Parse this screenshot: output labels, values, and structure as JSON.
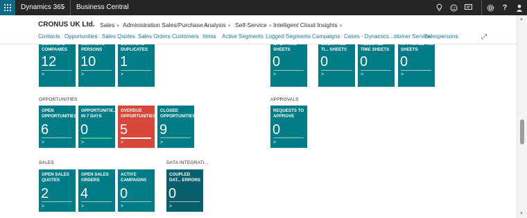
{
  "topbar": {
    "brand": "Dynamics 365",
    "product": "Business Central",
    "icons": [
      "waffle-icon",
      "chevron-down-icon",
      "lightbulb-icon",
      "smiley-icon",
      "chat-icon",
      "gear-icon",
      "help-icon",
      "user-icon"
    ]
  },
  "nav": {
    "company": "CRONUS UK Ltd.",
    "menus": [
      "Sales",
      "Administration Sales/Purchase",
      "Analysis",
      "Self-Service",
      "Intelligent Cloud Insights"
    ],
    "links": [
      "Contacts",
      "Opportunities",
      "Sales Quotes",
      "Sales Orders",
      "Customers",
      "Items",
      "Active Segments",
      "Logged Segments",
      "Campaigns",
      "Cases - Dynamics...stomer Service",
      "Salespersons"
    ],
    "expand_icon": "expand-icon"
  },
  "sections": {
    "opportunities": "OPPORTUNITIES",
    "approvals": "APPROVALS",
    "sales": "SALES",
    "data_integration": "DATA INTEGRATI..."
  },
  "tiles": {
    "contacts_companies": {
      "label": "CONTACTS - COMPANIES",
      "value": "12"
    },
    "contacts_persons": {
      "label": "CONTACTS - PERSONS",
      "value": "10"
    },
    "contacts_duplicates": {
      "label": "CONTACTS - DUPLICATES",
      "value": "1"
    },
    "open_time_sheets": {
      "label": "OPEN TIME SHEETS",
      "value": "0"
    },
    "submitted_time_sheets": {
      "label": "SUBMITTED TI... SHEETS",
      "value": "0"
    },
    "rejected_time_sheets": {
      "label": "REJECTED TIME SHEETS",
      "value": "0"
    },
    "approved_time_sheets": {
      "label": "APPROVED TI... SHEETS",
      "value": "0"
    },
    "open_opportunities": {
      "label": "OPEN OPPORTUNITIES",
      "value": "6"
    },
    "opportunities_7_days": {
      "label": "OPPORTUNITIE... IN 7 DAYS",
      "value": "0"
    },
    "overdue_opportunities": {
      "label": "OVERDUE OPPORTUNITIES",
      "value": "5"
    },
    "closed_opportunities": {
      "label": "CLOSED OPPORTUNITIES",
      "value": "9"
    },
    "requests_to_approve": {
      "label": "REQUESTS TO APPROVE",
      "value": "0"
    },
    "open_sales_quotes": {
      "label": "OPEN SALES QUOTES",
      "value": "2"
    },
    "open_sales_orders": {
      "label": "OPEN SALES ORDERS",
      "value": "4"
    },
    "active_campaigns": {
      "label": "ACTIVE CAMPAIGNS",
      "value": "0"
    },
    "coupled_data_errors": {
      "label": "COUPLED DAT... ERRORS",
      "value": "0"
    }
  },
  "tile_arrow": ">",
  "colors": {
    "tile": "#007c86",
    "tile_dark": "#07606b",
    "tile_alert": "#d7473a",
    "accent_green": "#31c48d",
    "link": "#1b7ea8",
    "topbar": "#262626"
  }
}
